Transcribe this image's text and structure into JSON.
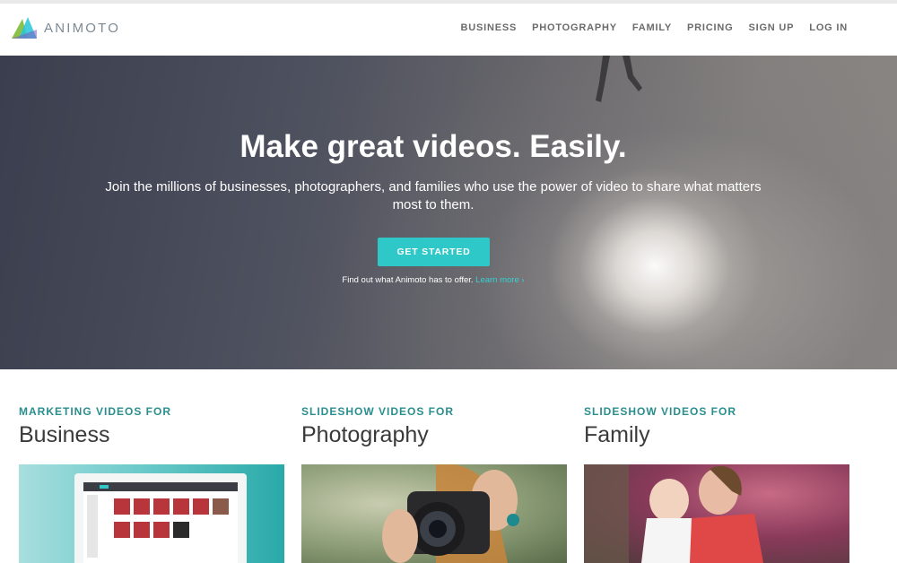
{
  "brand": {
    "name": "ANIMOTO"
  },
  "nav": {
    "items": [
      {
        "label": "BUSINESS"
      },
      {
        "label": "PHOTOGRAPHY"
      },
      {
        "label": "FAMILY"
      },
      {
        "label": "PRICING"
      },
      {
        "label": "SIGN UP"
      },
      {
        "label": "LOG IN"
      }
    ]
  },
  "hero": {
    "title": "Make great videos. Easily.",
    "subtitle": "Join the millions of businesses, photographers, and families who use the power of video to share what matters most to them.",
    "cta_label": "GET STARTED",
    "note_text": "Find out what Animoto has to offer.",
    "note_link": "Learn more ›"
  },
  "cards": [
    {
      "kicker": "MARKETING VIDEOS FOR",
      "heading": "Business"
    },
    {
      "kicker": "SLIDESHOW VIDEOS FOR",
      "heading": "Photography"
    },
    {
      "kicker": "SLIDESHOW VIDEOS FOR",
      "heading": "Family"
    }
  ],
  "colors": {
    "accent": "#2ec8c8",
    "kicker": "#2a8e8e",
    "nav_text": "#6b6b6b"
  }
}
